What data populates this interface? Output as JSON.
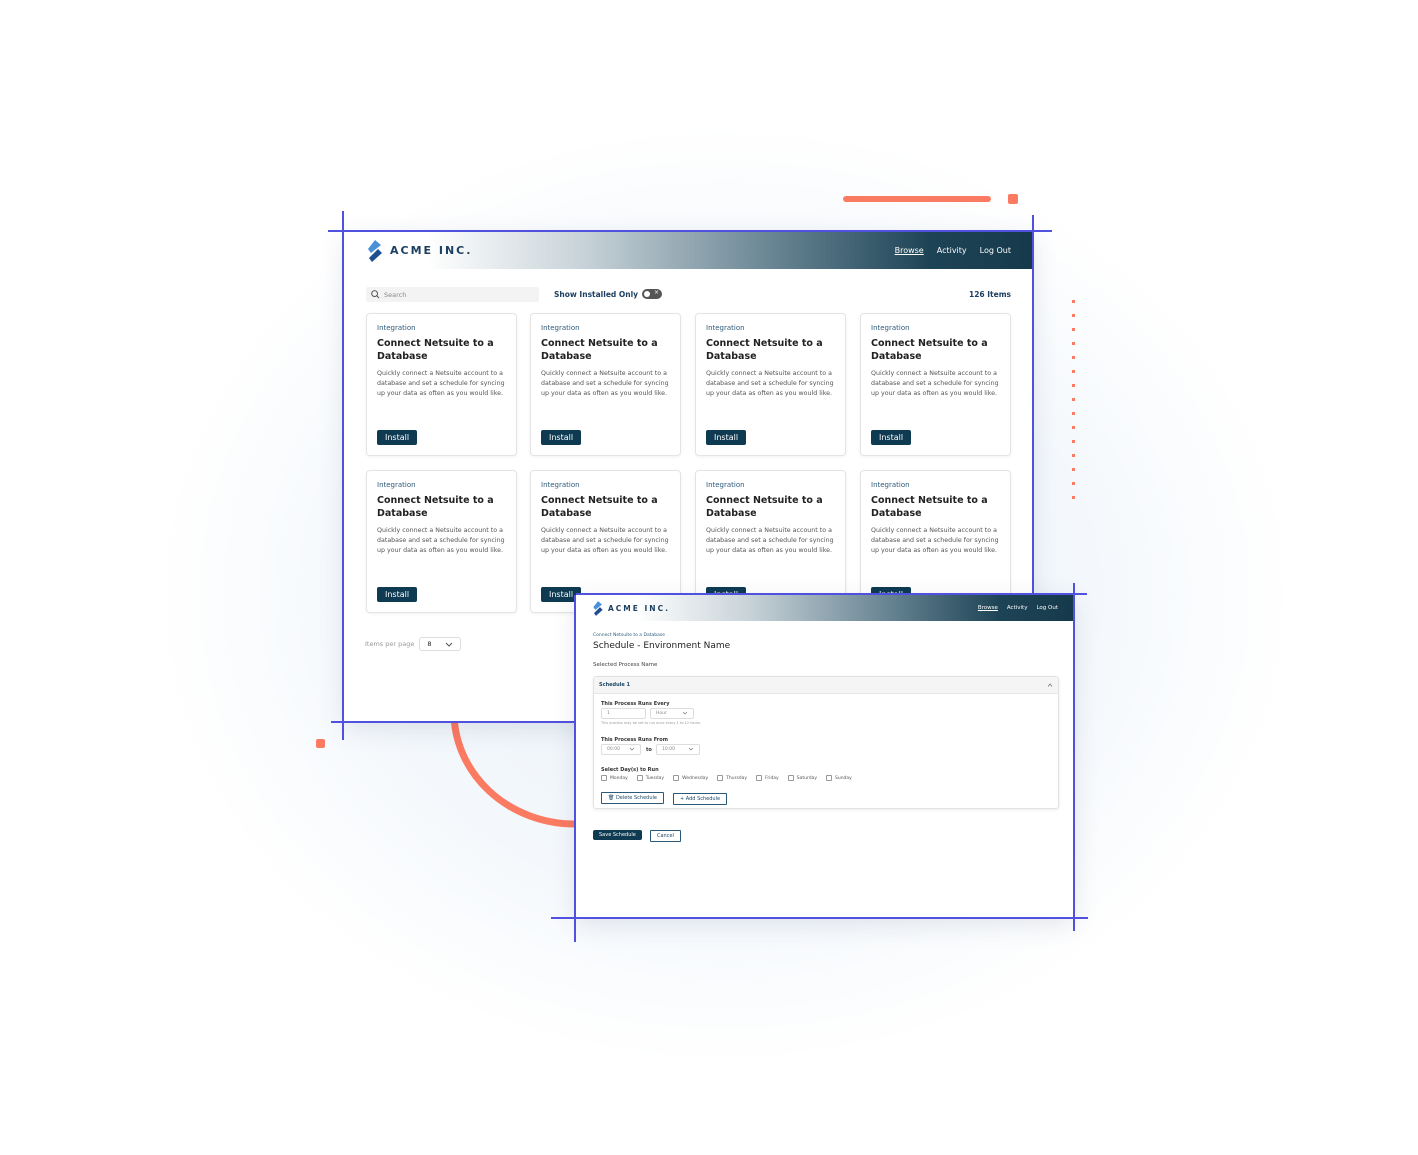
{
  "colors": {
    "accent": "#0e3a52",
    "frame_line": "#5151e0",
    "decor": "#fb7a62"
  },
  "main": {
    "brand": "ACME INC.",
    "nav": [
      "Browse",
      "Activity",
      "Log Out"
    ],
    "search_placeholder": "Search",
    "toggle_label": "Show Installed Only",
    "toggle_on": false,
    "count": "126 Items",
    "cards": [
      {
        "category": "Integration",
        "title": "Connect Netsuite to a Database",
        "desc": "Quickly connect a Netsuite account to a database and set a schedule for syncing up your data as often as you would like.",
        "button": "Install"
      },
      {
        "category": "Integration",
        "title": "Connect Netsuite to a Database",
        "desc": "Quickly connect a Netsuite account to a database and set a schedule for syncing up your data as often as you would like.",
        "button": "Install"
      },
      {
        "category": "Integration",
        "title": "Connect Netsuite to a Database",
        "desc": "Quickly connect a Netsuite account to a database and set a schedule for syncing up your data as often as you would like.",
        "button": "Install"
      },
      {
        "category": "Integration",
        "title": "Connect Netsuite to a Database",
        "desc": "Quickly connect a Netsuite account to a database and set a schedule for syncing up your data as often as you would like.",
        "button": "Install"
      },
      {
        "category": "Integration",
        "title": "Connect Netsuite to a Database",
        "desc": "Quickly connect a Netsuite account to a database and set a schedule for syncing up your data as often as you would like.",
        "button": "Install"
      },
      {
        "category": "Integration",
        "title": "Connect Netsuite to a Database",
        "desc": "Quickly connect a Netsuite account to a database and set a schedule for syncing up your data as often as you would like.",
        "button": "Install"
      },
      {
        "category": "Integration",
        "title": "Connect Netsuite to a Database",
        "desc": "Quickly connect a Netsuite account to a database and set a schedule for syncing up your data as often as you would like.",
        "button": "Install"
      },
      {
        "category": "Integration",
        "title": "Connect Netsuite to a Database",
        "desc": "Quickly connect a Netsuite account to a database and set a schedule for syncing up your data as often as you would like.",
        "button": "Install"
      }
    ],
    "per_page_label": "Items per page",
    "per_page_value": "8"
  },
  "schedule": {
    "brand": "ACME INC.",
    "nav": [
      "Browse",
      "Activity",
      "Log Out"
    ],
    "breadcrumb": "Connect Netsuite to a Database",
    "title": "Schedule - Environment Name",
    "process_name": "Selected Process Name",
    "panel_title": "Schedule 1",
    "runs_every_label": "This Process Runs Every",
    "runs_every_value": "1",
    "runs_every_unit": "Hour",
    "runs_every_help": "This process may be set to run once every 1 to 12 hours.",
    "runs_from_label": "This Process Runs From",
    "from_value": "00:00",
    "to_label": "to",
    "to_value": "10:00",
    "days_label": "Select Day(s) to Run",
    "days": [
      "Monday",
      "Tuesday",
      "Wednesday",
      "Thursday",
      "Friday",
      "Saturday",
      "Sunday"
    ],
    "delete_button": "Delete Schedule",
    "add_button": "Add Schedule",
    "save_button": "Save Schedule",
    "cancel_button": "Cancel"
  }
}
